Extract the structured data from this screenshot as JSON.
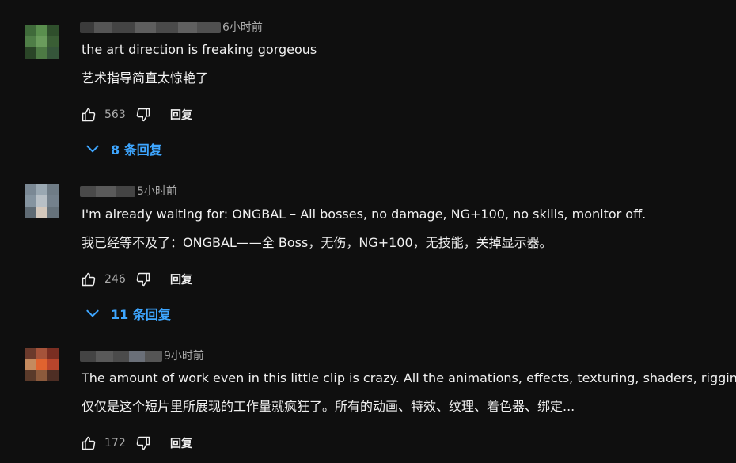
{
  "comments": [
    {
      "timestamp": "6小时前",
      "text_en": "the art direction is freaking gorgeous",
      "text_zh": "艺术指导简直太惊艳了",
      "likes": "563",
      "reply_label": "回复",
      "replies_label": "8 条回复"
    },
    {
      "timestamp": "5小时前",
      "text_en": "I'm already waiting for: ONGBAL – All bosses, no damage, NG+100, no skills, monitor off.",
      "text_zh": "我已经等不及了：ONGBAL——全 Boss，无伤，NG+100，无技能，关掉显示器。",
      "likes": "246",
      "reply_label": "回复",
      "replies_label": "11 条回复"
    },
    {
      "timestamp": "9小时前",
      "text_en": "The amount of work even in this little clip is crazy. All the animations, effects, texturing, shaders, rigging...",
      "text_zh": "仅仅是这个短片里所展现的工作量就疯狂了。所有的动画、特效、纹理、着色器、绑定...",
      "likes": "172",
      "reply_label": "回复"
    }
  ],
  "icons": {
    "like": "thumbs-up-icon",
    "dislike": "thumbs-down-icon",
    "expand": "chevron-down-icon"
  },
  "colors": {
    "background": "#0f0f0f",
    "text": "#f1f1f1",
    "secondary_text": "#aaaaaa",
    "accent": "#3ea6ff"
  }
}
